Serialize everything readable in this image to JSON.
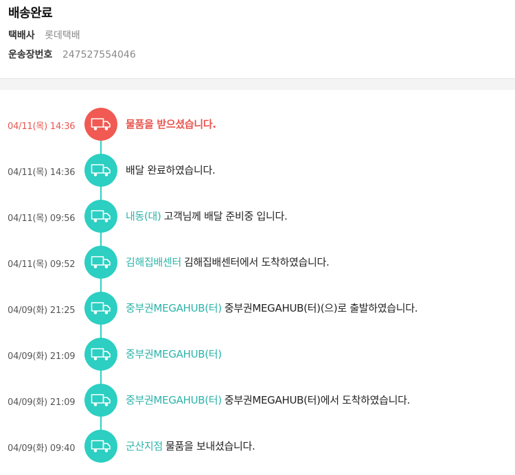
{
  "header": {
    "status": "배송완료",
    "carrier_label": "택배사",
    "carrier_value": "롯데택배",
    "tracking_label": "운송장번호",
    "tracking_value": "247527554046"
  },
  "colors": {
    "accent_teal": "#2ccfc1",
    "latest_red": "#f05a52",
    "location_text": "#2bb3a8"
  },
  "timeline": [
    {
      "time": "04/11(목) 14:36",
      "location": "",
      "message": "물품을 받으셨습니다.",
      "icon": "truck-icon",
      "latest": true
    },
    {
      "time": "04/11(목) 14:36",
      "location": "",
      "message": "배달 완료하였습니다.",
      "icon": "truck-icon"
    },
    {
      "time": "04/11(목) 09:56",
      "location": "내동(대)",
      "message": "고객님께 배달 준비중 입니다.",
      "icon": "truck-icon"
    },
    {
      "time": "04/11(목) 09:52",
      "location": "김해집배센터",
      "message": "김해집배센터에서 도착하였습니다.",
      "icon": "truck-icon"
    },
    {
      "time": "04/09(화) 21:25",
      "location": "중부권MEGAHUB(터)",
      "message": "중부권MEGAHUB(터)(으)로 출발하였습니다.",
      "icon": "truck-icon"
    },
    {
      "time": "04/09(화) 21:09",
      "location": "중부권MEGAHUB(터)",
      "message": "",
      "icon": "truck-icon"
    },
    {
      "time": "04/09(화) 21:09",
      "location": "중부권MEGAHUB(터)",
      "message": "중부권MEGAHUB(터)에서 도착하였습니다.",
      "icon": "truck-icon"
    },
    {
      "time": "04/09(화) 09:40",
      "location": "군산지점",
      "message": "물품을 보내셨습니다.",
      "icon": "truck-icon"
    }
  ]
}
